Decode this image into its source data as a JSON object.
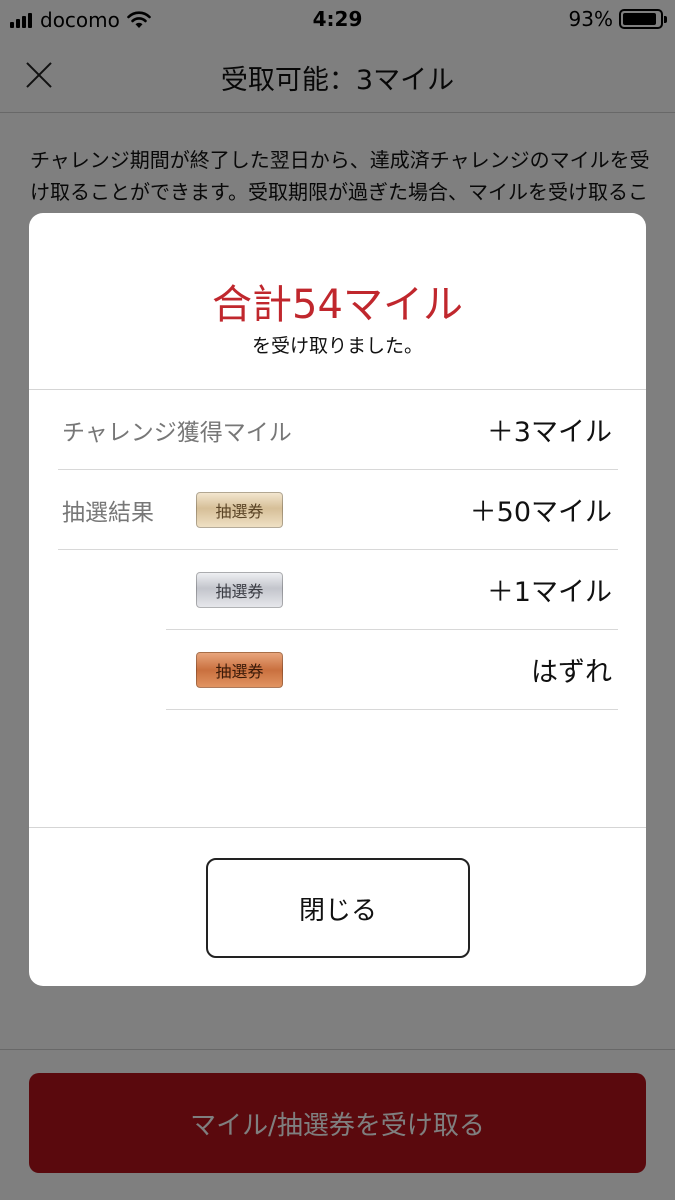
{
  "status_bar": {
    "carrier": "docomo",
    "time": "4:29",
    "battery": "93%",
    "battery_level": 0.93
  },
  "nav": {
    "title": "受取可能：3マイル"
  },
  "description": "チャレンジ期間が終了した翌日から、達成済チャレンジのマイルを受け取ることができます。受取期限が過ぎた場合、マイルを受け取ることができません。",
  "bottom_button": {
    "label": "マイル/抽選券を受け取る"
  },
  "modal": {
    "total": "合計54マイル",
    "subtitle": "を受け取りました。",
    "challenge_row": {
      "label": "チャレンジ獲得マイル",
      "value": "＋3マイル"
    },
    "lottery_label": "抽選結果",
    "lottery_results": [
      {
        "ticket": "抽選券",
        "tier": "gold",
        "value": "＋50マイル"
      },
      {
        "ticket": "抽選券",
        "tier": "silver",
        "value": "＋1マイル"
      },
      {
        "ticket": "抽選券",
        "tier": "bronze",
        "value": "はずれ"
      }
    ],
    "close_label": "閉じる"
  }
}
